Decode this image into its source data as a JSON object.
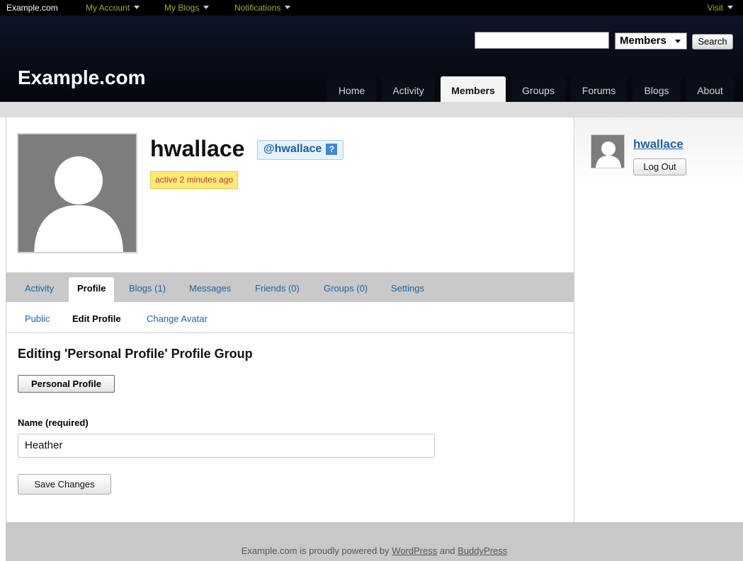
{
  "adminbar": {
    "brand": "Example.com",
    "menus": [
      "My Account",
      "My Blogs",
      "Notifications"
    ],
    "visit": "Visit"
  },
  "header": {
    "site_title": "Example.com",
    "search_placeholder": "",
    "search_scope": "Members",
    "search_button": "Search",
    "nav": [
      "Home",
      "Activity",
      "Members",
      "Groups",
      "Forums",
      "Blogs",
      "About"
    ],
    "active_nav": "Members"
  },
  "profile": {
    "username": "hwallace",
    "handle": "@hwallace",
    "handle_help": "?",
    "activity": "active 2 minutes ago"
  },
  "tabs": {
    "items": [
      "Activity",
      "Profile",
      "Blogs (1)",
      "Messages",
      "Friends (0)",
      "Groups (0)",
      "Settings"
    ],
    "active": "Profile"
  },
  "subtabs": {
    "items": [
      "Public",
      "Edit Profile",
      "Change Avatar"
    ],
    "active": "Edit Profile"
  },
  "form": {
    "title": "Editing 'Personal Profile' Profile Group",
    "group_button": "Personal Profile",
    "name_label": "Name (required)",
    "name_value": "Heather",
    "save_label": "Save Changes"
  },
  "sidebar": {
    "username": "hwallace",
    "logout": "Log Out"
  },
  "footer": {
    "prefix": "Example.com is proudly powered by ",
    "link1": "WordPress",
    "middle": " and ",
    "link2": "BuddyPress"
  },
  "colors": {
    "link": "#1f63a8",
    "accent_menu": "#9ab026",
    "header_bg": "#05070d"
  }
}
